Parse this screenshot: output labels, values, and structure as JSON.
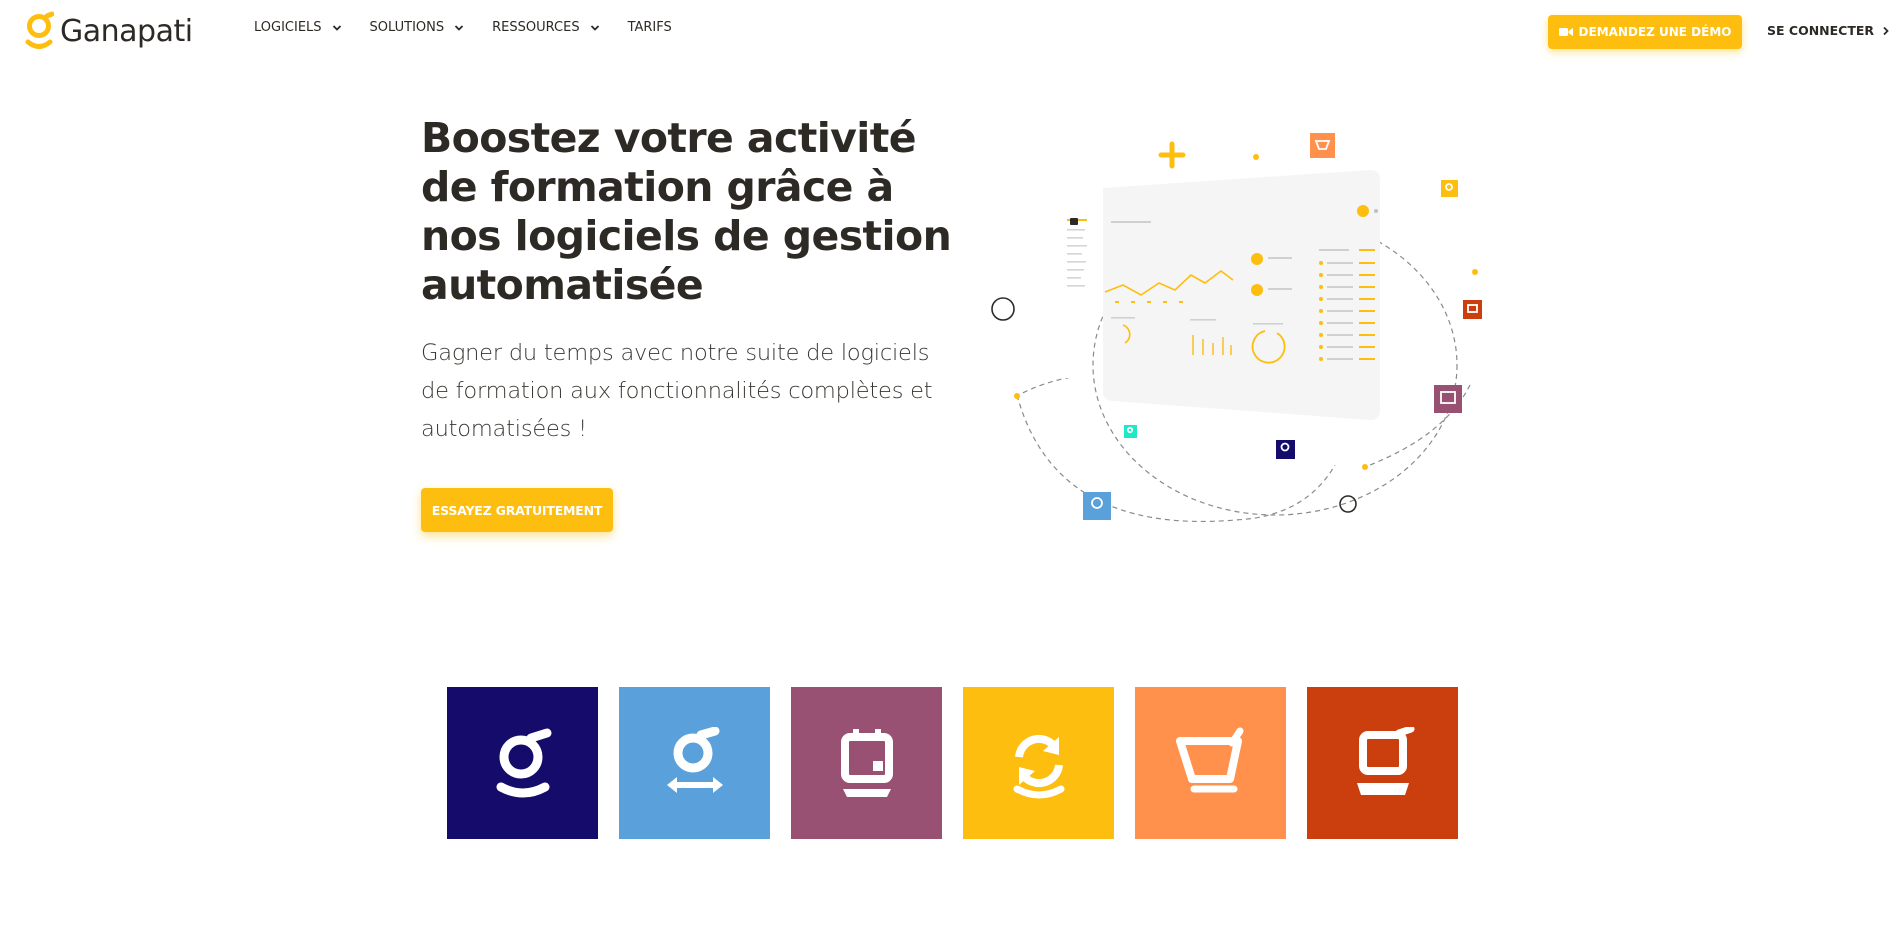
{
  "brand": {
    "name": "Ganapati",
    "accent": "#fdbe0f"
  },
  "nav": {
    "items": [
      {
        "label": "LOGICIELS",
        "has_dropdown": true
      },
      {
        "label": "SOLUTIONS",
        "has_dropdown": true
      },
      {
        "label": "RESSOURCES",
        "has_dropdown": true
      },
      {
        "label": "TARIFS",
        "has_dropdown": false
      }
    ],
    "demo_label": "DEMANDEZ UNE DÉMO",
    "login_label": "SE CONNECTER"
  },
  "hero": {
    "title": "Boostez votre activité de formation grâce à nos logiciels de gestion automatisée",
    "subtitle": "Gagner du temps avec notre suite de logiciels de formation aux fonctionnalités complètes et automatisées !",
    "cta_label": "ESSAYEZ GRATUITEMENT"
  },
  "products": [
    {
      "icon": "ganapati-g-icon",
      "color": "#140b6b"
    },
    {
      "icon": "ganapati-exchange-icon",
      "color": "#5aa0db"
    },
    {
      "icon": "ganapati-calendar-icon",
      "color": "#985073"
    },
    {
      "icon": "ganapati-sync-icon",
      "color": "#fdbe0f"
    },
    {
      "icon": "ganapati-cart-icon",
      "color": "#ff914d"
    },
    {
      "icon": "ganapati-laptop-icon",
      "color": "#cb3e0e"
    }
  ]
}
